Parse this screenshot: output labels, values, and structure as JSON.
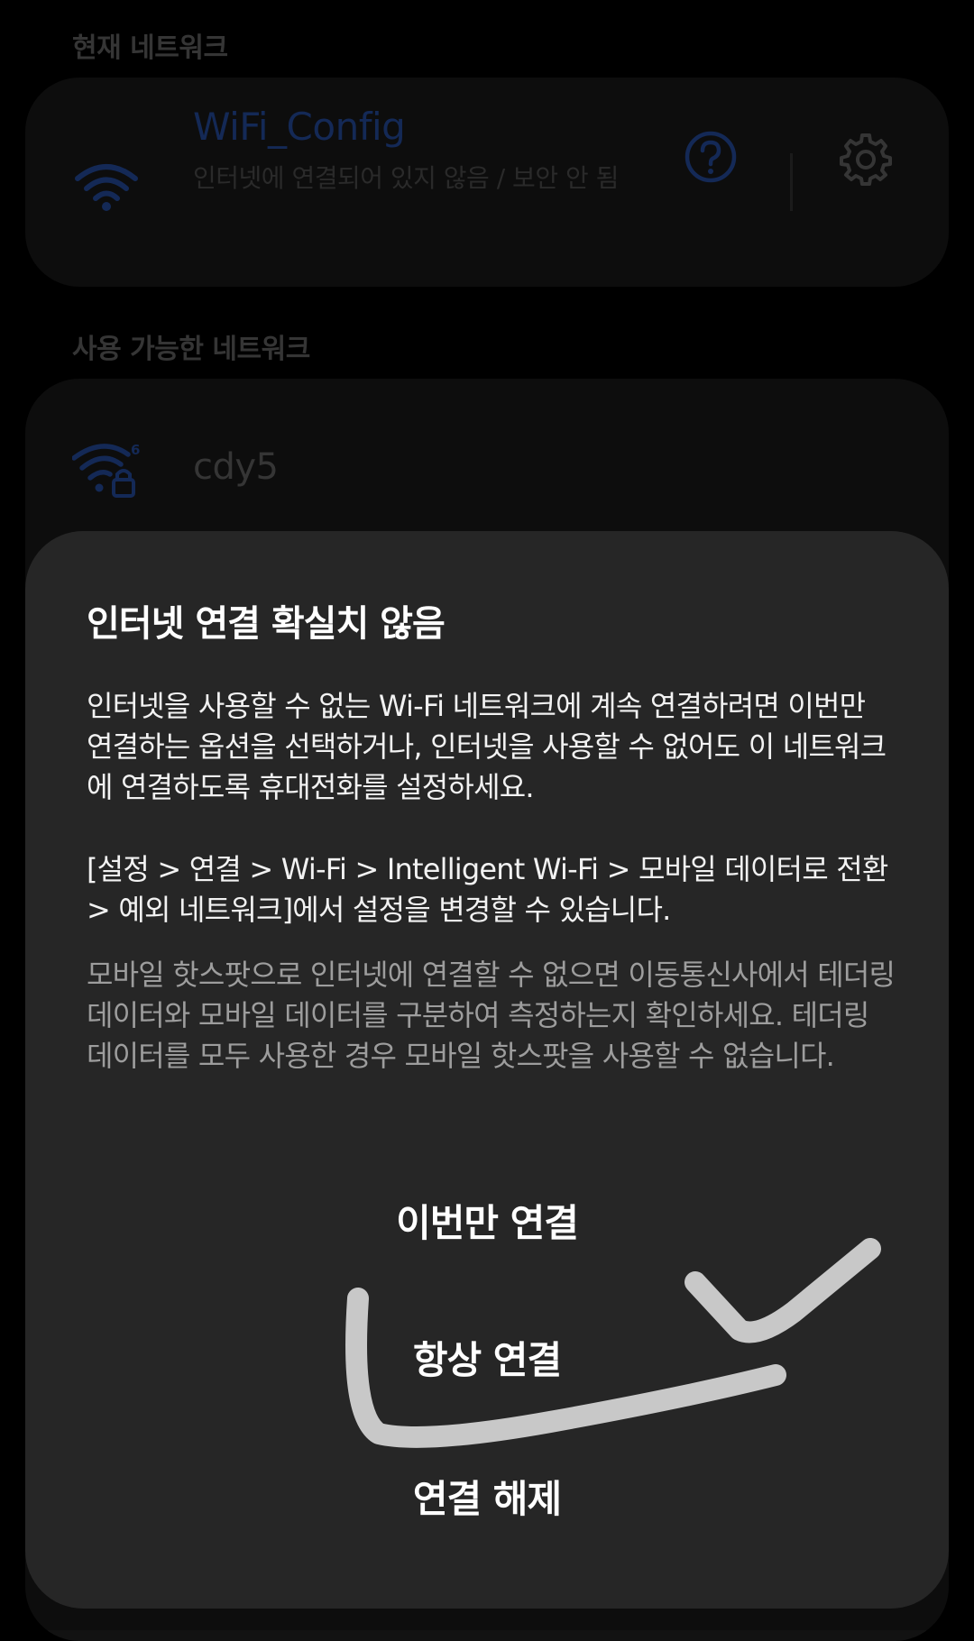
{
  "current_network": {
    "header": "현재 네트워크",
    "ssid": "WiFi_Config",
    "status": "인터넷에 연결되어 있지 않음 / 보안 안 됨",
    "wifi_icon": "wifi-icon",
    "info_icon": "question-circle-icon",
    "settings_icon": "gear-icon"
  },
  "available_networks": {
    "header": "사용 가능한 네트워크",
    "items": [
      {
        "ssid": "cdy5",
        "icon": "wifi6-locked-icon"
      }
    ]
  },
  "dialog": {
    "title": "인터넷 연결 확실치 않음",
    "message": "인터넷을 사용할 수 없는 Wi-Fi 네트워크에 계속 연결하려면 이번만 연결하는 옵션을 선택하거나, 인터넷을 사용할 수 없어도 이 네트워크에 연결하도록 휴대전화를 설정하세요.",
    "path_info": "[설정 > 연결 > Wi-Fi > Intelligent Wi-Fi > 모바일 데이터로 전환 > 예외 네트워크]에서 설정을 변경할 수 있습니다.",
    "hotspot_note": "모바일 핫스팟으로 인터넷에 연결할 수 없으면 이동통신사에서 테더링 데이터와 모바일 데이터를 구분하여 측정하는지 확인하세요. 테더링 데이터를 모두 사용한 경우 모바일 핫스팟을 사용할 수 없습니다.",
    "buttons": {
      "connect_once": "이번만 연결",
      "always_connect": "항상 연결",
      "disconnect": "연결 해제"
    }
  },
  "colors": {
    "background": "#000000",
    "card": "#121212",
    "dialog": "#262626",
    "accent_blue": "#1c3a78",
    "annotation": "#c8c8c8"
  },
  "annotation": "hand-drawn-checkmark-highlighting-always-connect"
}
